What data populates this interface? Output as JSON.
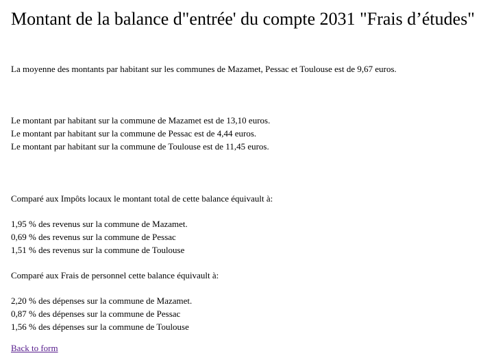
{
  "title": "Montant de la balance d\"entrée' du compte 2031 \"Frais d’études\"",
  "average": "La moyenne des montants par habitant sur les communes de Mazamet, Pessac et Toulouse est de 9,67 euros.",
  "per_inhabitant": [
    "Le montant par habitant sur la commune de Mazamet est de 13,10 euros.",
    "Le montant par habitant sur la commune de Pessac est de 4,44 euros.",
    "Le montant par habitant sur la commune de Toulouse est de 11,45 euros."
  ],
  "impots": {
    "heading": "Comparé aux Impôts locaux le montant total de cette balance équivault à:",
    "items": [
      "1,95 % des revenus sur la commune de Mazamet.",
      "0,69 % des revenus sur la commune de Pessac",
      "1,51 % des revenus sur la commune de Toulouse"
    ]
  },
  "personnel": {
    "heading": "Comparé aux Frais de personnel cette balance équivault à:",
    "items": [
      "2,20 % des dépenses sur la commune de Mazamet.",
      "0,87 % des dépenses sur la commune de Pessac",
      "1,56 % des dépenses sur la commune de Toulouse"
    ]
  },
  "back_link": "Back to form"
}
